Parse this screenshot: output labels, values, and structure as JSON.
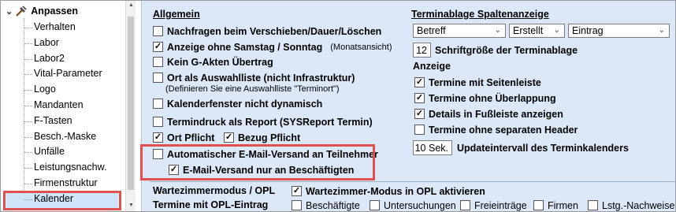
{
  "sidebar": {
    "header": "Anpassen",
    "items": [
      {
        "label": "Verhalten"
      },
      {
        "label": "Labor"
      },
      {
        "label": "Labor2"
      },
      {
        "label": "Vital-Parameter"
      },
      {
        "label": "Logo"
      },
      {
        "label": "Mandanten"
      },
      {
        "label": "F-Tasten"
      },
      {
        "label": "Besch.-Maske"
      },
      {
        "label": "Unfälle"
      },
      {
        "label": "Leistungsnachw."
      },
      {
        "label": "Firmenstruktur"
      },
      {
        "label": "Kalender",
        "selected": true
      }
    ]
  },
  "allgemein": {
    "title": "Allgemein",
    "options": [
      {
        "label": "Nachfragen beim Verschieben/Dauer/Löschen",
        "checked": false
      },
      {
        "label": "Anzeige ohne Samstag / Sonntag",
        "checked": true,
        "note": "(Monatsansicht)"
      },
      {
        "label": "Kein G-Akten Übertrag",
        "checked": false
      },
      {
        "label": "Ort als Auswahlliste (nicht Infrastruktur)",
        "checked": false,
        "note": "(Definieren Sie eine Auswahlliste \"Terminort\")"
      },
      {
        "label": "Kalenderfenster nicht dynamisch",
        "checked": false
      },
      {
        "label": "Termindruck als Report (SYSReport Termin)",
        "checked": false
      }
    ],
    "ort_pflicht": {
      "label": "Ort Pflicht",
      "checked": true
    },
    "bezug_pflicht": {
      "label": "Bezug Pflicht",
      "checked": true
    },
    "email_auto": {
      "label": "Automatischer E-Mail-Versand an Teilnehmer",
      "checked": false
    },
    "email_staff": {
      "label": "E-Mail-Versand nur an Beschäftigten",
      "checked": true
    }
  },
  "terminablage": {
    "title": "Terminablage Spaltenanzeige",
    "columns": [
      "Betreff",
      "Erstellt",
      "Eintrag"
    ],
    "font_size_value": "12",
    "font_size_label": "Schriftgröße der Terminablage"
  },
  "anzeige": {
    "title": "Anzeige",
    "options": [
      {
        "label": "Termine mit Seitenleiste",
        "checked": true
      },
      {
        "label": "Termine ohne Überlappung",
        "checked": true
      },
      {
        "label": "Details in Fußleiste anzeigen",
        "checked": true
      },
      {
        "label": "Termine ohne separaten Header",
        "checked": false
      }
    ],
    "update_value": "10 Sek.",
    "update_label": "Updateintervall des Terminkalenders"
  },
  "warte": {
    "title": "Wartezimmermodus / OPL",
    "opl_title": "Termine mit OPL-Eintrag",
    "activate": {
      "label": "Wartezimmer-Modus in OPL aktivieren",
      "checked": true
    },
    "filters": [
      {
        "label": "Beschäftigte",
        "checked": false
      },
      {
        "label": "Untersuchungen",
        "checked": false
      },
      {
        "label": "Freieinträge",
        "checked": false
      },
      {
        "label": "Firmen",
        "checked": false
      },
      {
        "label": "Lstg.-Nachweise",
        "checked": false
      }
    ]
  },
  "icons": {
    "checkmark": "✓",
    "dropdown": "⌄"
  },
  "colors": {
    "highlight": "#e05050",
    "panel": "#dce8f7",
    "selection": "#cfe4f7"
  }
}
